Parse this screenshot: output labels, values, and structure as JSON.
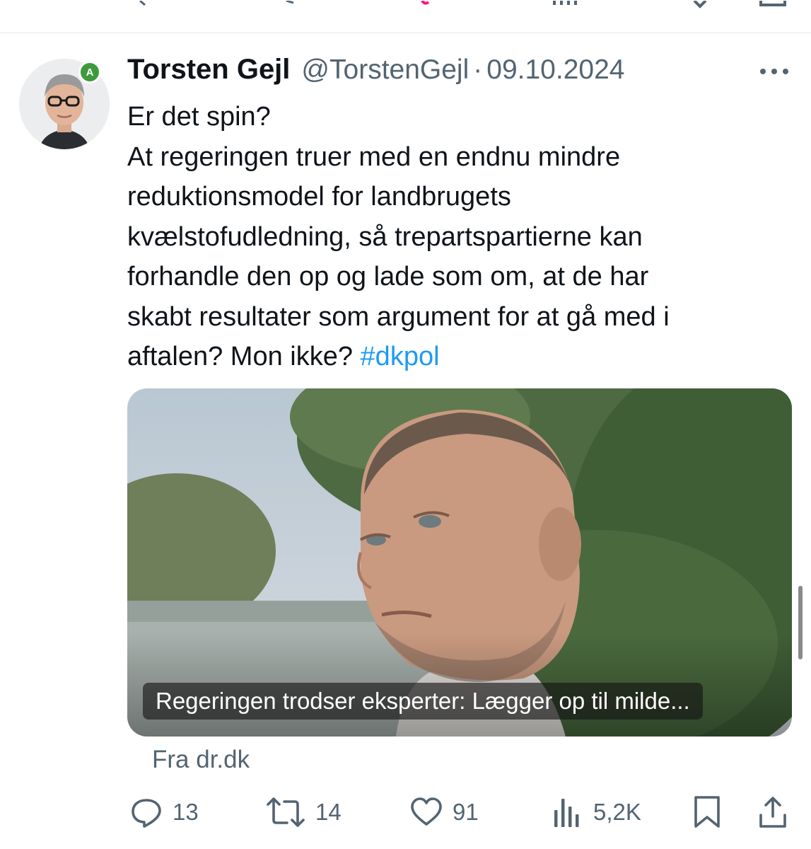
{
  "tweet": {
    "author_name": "Torsten Gejl",
    "handle": "@TorstenGejl",
    "separator": "·",
    "date": "09.10.2024",
    "text_lines": [
      "Er det spin?",
      "At regeringen truer med en endnu mindre",
      "reduktionsmodel for landbrugets",
      "kvælstofudledning, så trepartspartierne kan",
      "forhandle den op og lade som om, at de har",
      "skabt resultater som argument for at gå med i"
    ],
    "last_line_text": "aftalen? Mon ikke?",
    "hashtag": "#dkpol",
    "avatar_badge": "A"
  },
  "card": {
    "title": "Regeringen trodser eksperter: Lægger op til milde...",
    "source": "Fra dr.dk"
  },
  "actions": {
    "replies": "13",
    "reposts": "14",
    "likes": "91",
    "views": "5,2K"
  },
  "colors": {
    "text": "#0f1419",
    "secondary": "#536471",
    "hashtag": "#1d9bf0",
    "party_badge": "#3e9a3c"
  },
  "icons": [
    "reply-icon",
    "repost-icon",
    "like-icon",
    "views-icon",
    "bookmark-icon",
    "share-icon",
    "more-icon"
  ]
}
